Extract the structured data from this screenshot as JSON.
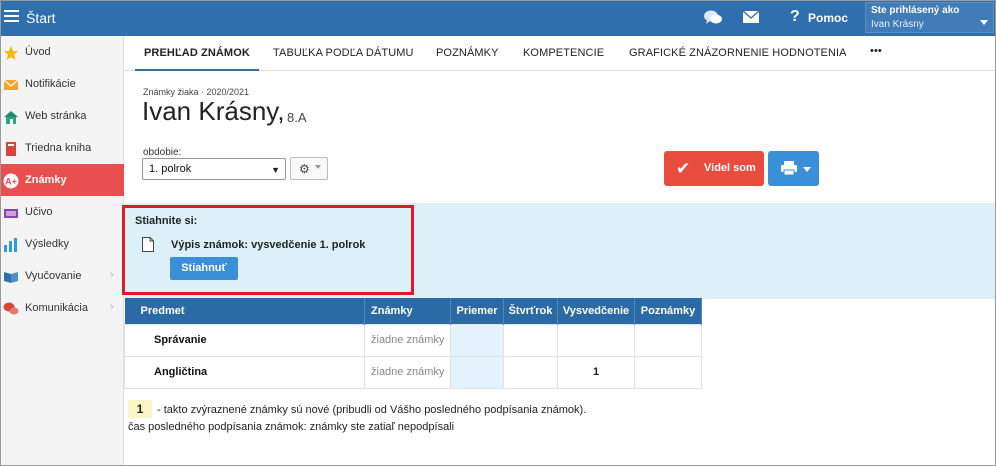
{
  "topbar": {
    "title": "Štart",
    "help_label": "Pomoc",
    "user_heading": "Ste prihlásený ako",
    "user_name": "Ivan Krásny"
  },
  "sidebar": {
    "items": [
      {
        "label": "Úvod",
        "icon": "star-icon"
      },
      {
        "label": "Notifikácie",
        "icon": "envelope-icon"
      },
      {
        "label": "Web stránka",
        "icon": "house-icon"
      },
      {
        "label": "Triedna kniha",
        "icon": "book-icon"
      },
      {
        "label": "Známky",
        "icon": "grade-icon",
        "active": true
      },
      {
        "label": "Učivo",
        "icon": "lesson-icon"
      },
      {
        "label": "Výsledky",
        "icon": "bar-chart-icon"
      },
      {
        "label": "Vyučovanie",
        "icon": "open-book-icon",
        "expandable": true
      },
      {
        "label": "Komunikácia",
        "icon": "chat-bubbles-icon",
        "expandable": true
      }
    ],
    "chevron": "›"
  },
  "tabs": [
    {
      "label": "PREHĽAD ZNÁMOK",
      "active": true
    },
    {
      "label": "TABUĽKA PODĽA DÁTUMU"
    },
    {
      "label": "POZNÁMKY"
    },
    {
      "label": "KOMPETENCIE"
    },
    {
      "label": "GRAFICKÉ ZNÁZORNENIE HODNOTENIA"
    },
    {
      "label": "•••"
    }
  ],
  "header": {
    "subtitle": "Známky žiaka · 2020/2021",
    "student_name": "Ivan Krásny,",
    "student_class": "8.A",
    "period_label": "obdobie:",
    "period_value": "1. polrok",
    "seen_button": "Videl som"
  },
  "download": {
    "title": "Stiahnite si:",
    "file_label": "Výpis známok: vysvedčenie 1. polrok",
    "button": "Stiahnuť"
  },
  "grades_table": {
    "columns": [
      "Predmet",
      "Známky",
      "Priemer",
      "Štvrťrok",
      "Vysvedčenie",
      "Poznámky"
    ],
    "rows": [
      {
        "subject": "Správanie",
        "grades": "žiadne známky",
        "average": "",
        "quarter": "",
        "report": "",
        "notes": ""
      },
      {
        "subject": "Angličtina",
        "grades": "žiadne známky",
        "average": "",
        "quarter": "",
        "report": "1",
        "notes": ""
      }
    ]
  },
  "legend": {
    "sample": "1",
    "text": "- takto zvýraznené známky sú nové (pribudli od Vášho posledného podpísania známok).",
    "last_signed": "čas posledného podpísania známok: známky ste zatiaľ nepodpísali"
  },
  "colors": {
    "topbar": "#2f6fad",
    "active_sidebar": "#ea4f4f",
    "seen_button": "#e74c3c",
    "primary_button": "#3a8fd9",
    "band": "#dcf0f8",
    "highlight_frame": "#e01b24",
    "table_header": "#2c6aa6"
  }
}
